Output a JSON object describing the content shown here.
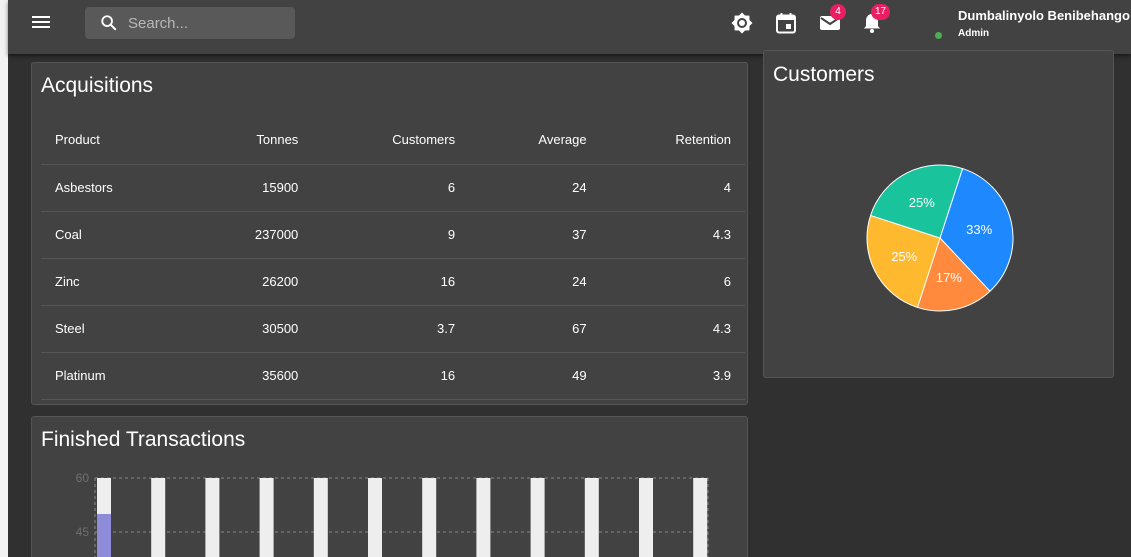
{
  "header": {
    "search_placeholder": "Search...",
    "mail_count": "4",
    "notification_count": "17",
    "user_name": "Dumbalinyolo Benibehango",
    "user_role": "Admin"
  },
  "colors": {
    "accent_badge": "#e91e63",
    "status_online": "#4caf50"
  },
  "icons": [
    "menu-icon",
    "search-icon",
    "brightness-icon",
    "calendar-icon",
    "mail-icon",
    "bell-icon"
  ],
  "acquisitions": {
    "title": "Acquisitions",
    "columns": [
      "Product",
      "Tonnes",
      "Customers",
      "Average",
      "Retention"
    ],
    "rows": [
      [
        "Asbestors",
        "15900",
        "6",
        "24",
        "4"
      ],
      [
        "Coal",
        "237000",
        "9",
        "37",
        "4.3"
      ],
      [
        "Zinc",
        "26200",
        "16",
        "24",
        "6"
      ],
      [
        "Steel",
        "30500",
        "3.7",
        "67",
        "4.3"
      ],
      [
        "Platinum",
        "35600",
        "16",
        "49",
        "3.9"
      ]
    ]
  },
  "customers": {
    "title": "Customers"
  },
  "finished_transactions": {
    "title": "Finished Transactions"
  },
  "chart_data": [
    {
      "type": "pie",
      "slices": [
        {
          "label": "33%",
          "value": 33,
          "color": "#1e88ff"
        },
        {
          "label": "17%",
          "value": 17,
          "color": "#ff8a3d"
        },
        {
          "label": "25%",
          "value": 25,
          "color": "#ffb92e"
        },
        {
          "label": "25%",
          "value": 25,
          "color": "#19c39c"
        }
      ]
    },
    {
      "type": "bar",
      "yticks": [
        "60",
        "45"
      ],
      "ylim": [
        0,
        60
      ],
      "grid": true,
      "bar_count": 12,
      "highlight_value": 50,
      "highlight_color": "#8e8cd8"
    }
  ]
}
